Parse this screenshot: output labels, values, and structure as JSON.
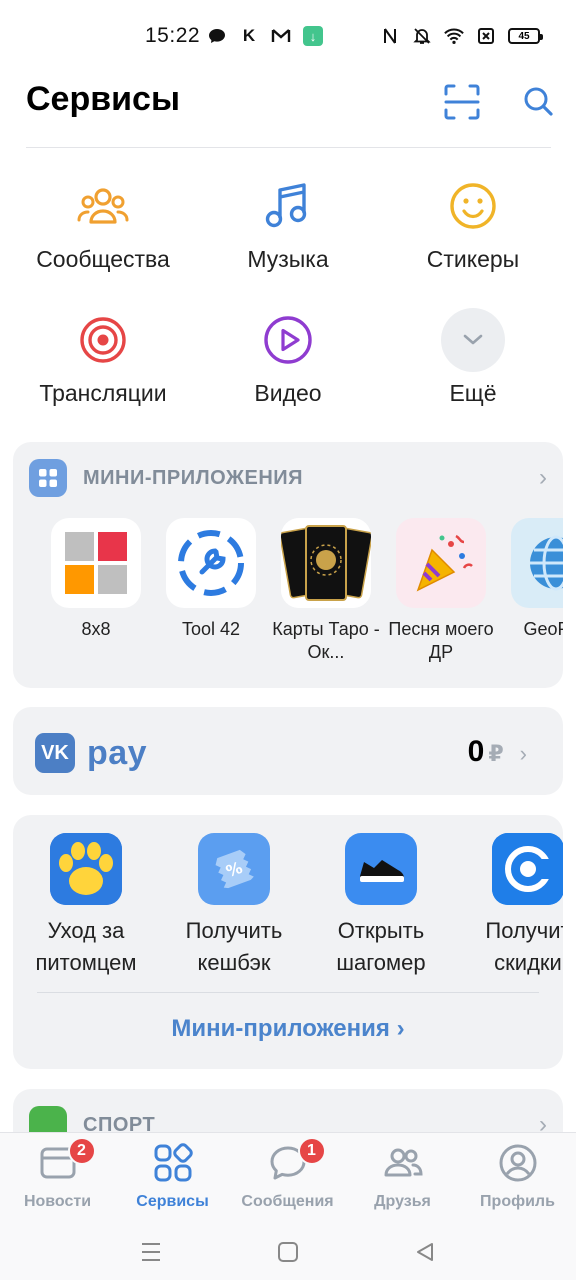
{
  "status_bar": {
    "time": "15:22",
    "left_icons": [
      "chat-bubble-icon",
      "k-icon",
      "gmail-icon",
      "download-icon"
    ],
    "right_icons": [
      "nfc-icon",
      "mute-icon",
      "wifi-icon",
      "sim-icon",
      "battery-icon"
    ],
    "battery": "45"
  },
  "header": {
    "title": "Сервисы",
    "actions": [
      "qr-scan-icon",
      "search-icon"
    ]
  },
  "services": [
    {
      "label": "Сообщества",
      "icon": "community-icon",
      "color": "#f0a030"
    },
    {
      "label": "Музыка",
      "icon": "music-icon",
      "color": "#3f82d8"
    },
    {
      "label": "Стикеры",
      "icon": "smile-icon",
      "color": "#f0b428"
    },
    {
      "label": "Трансляции",
      "icon": "broadcast-icon",
      "color": "#e64646"
    },
    {
      "label": "Видео",
      "icon": "video-icon",
      "color": "#8f3cd0"
    },
    {
      "label": "Ещё",
      "icon": "chevron-down-icon",
      "color": "#99a2ad"
    }
  ],
  "mini_apps": {
    "title": "МИНИ-ПРИЛОЖЕНИЯ",
    "apps": [
      {
        "name": "8x8"
      },
      {
        "name": "Tool 42"
      },
      {
        "name": "Карты Таро - Ок..."
      },
      {
        "name": "Песня моего ДР"
      },
      {
        "name": "GeoPuz"
      }
    ]
  },
  "vk_pay": {
    "logo": "VK",
    "word": "pay",
    "balance": "0",
    "currency": "₽"
  },
  "promo": {
    "items": [
      {
        "text1": "Уход за",
        "text2": "питомцем"
      },
      {
        "text1": "Получить",
        "text2": "кешбэк"
      },
      {
        "text1": "Открыть",
        "text2": "шагомер"
      },
      {
        "text1": "Получит",
        "text2": "скидки"
      }
    ],
    "link": "Мини-приложения ›"
  },
  "sport": {
    "title": "СПОРТ"
  },
  "bottom_nav": [
    {
      "label": "Новости",
      "badge": "2",
      "icon": "news-icon"
    },
    {
      "label": "Сервисы",
      "badge": "",
      "icon": "services-icon",
      "active": true
    },
    {
      "label": "Сообщения",
      "badge": "1",
      "icon": "messages-icon"
    },
    {
      "label": "Друзья",
      "badge": "",
      "icon": "friends-icon"
    },
    {
      "label": "Профиль",
      "badge": "",
      "icon": "profile-icon"
    }
  ],
  "colors": {
    "accent": "#3f82d8",
    "card_bg": "#f1f2f4",
    "badge": "#e64646"
  }
}
